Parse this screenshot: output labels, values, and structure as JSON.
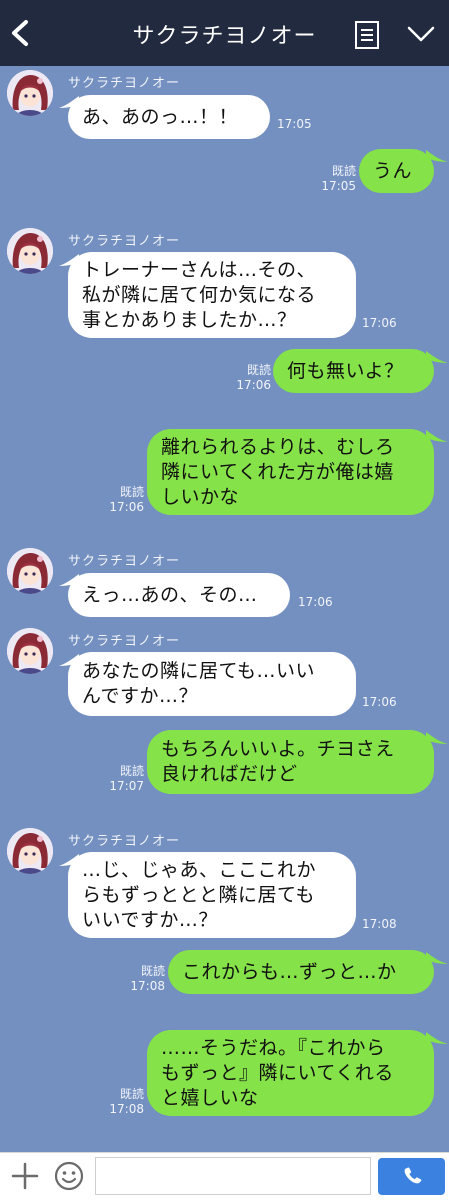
{
  "header": {
    "title": "サクラチヨノオー"
  },
  "messages": [
    {
      "sender": "サクラチヨノオー",
      "lines": [
        "あ、あのっ…！！"
      ],
      "time": "17:05"
    },
    {
      "read": "既読",
      "time": "17:05",
      "lines": [
        "うん"
      ]
    },
    {
      "sender": "サクラチヨノオー",
      "lines": [
        "トレーナーさんは…その、",
        "私が隣に居て何か気になる",
        "事とかありましたか…？"
      ],
      "time": "17:06"
    },
    {
      "read": "既読",
      "time": "17:06",
      "lines": [
        "何も無いよ？"
      ]
    },
    {
      "read": "既読",
      "time": "17:06",
      "lines": [
        "離れられるよりは、むしろ",
        "隣にいてくれた方が俺は嬉",
        "しいかな"
      ]
    },
    {
      "sender": "サクラチヨノオー",
      "lines": [
        "えっ…あの、その…"
      ],
      "time": "17:06"
    },
    {
      "sender": "サクラチヨノオー",
      "lines": [
        "あなたの隣に居ても…いい",
        "んですか…？"
      ],
      "time": "17:06"
    },
    {
      "read": "既読",
      "time": "17:07",
      "lines": [
        "もちろんいいよ。チヨさえ",
        "良ければだけど"
      ]
    },
    {
      "sender": "サクラチヨノオー",
      "lines": [
        "…じ、じゃあ、こここれか",
        "らもずっととと隣に居ても",
        "いいですか…？"
      ],
      "time": "17:08"
    },
    {
      "read": "既読",
      "time": "17:08",
      "lines": [
        "これからも…ずっと…か"
      ]
    },
    {
      "read": "既読",
      "time": "17:08",
      "lines": [
        "……そうだね。『これから",
        "もずっと』隣にいてくれる",
        "と嬉しいな"
      ]
    }
  ],
  "footer": {
    "input_value": "",
    "input_placeholder": ""
  },
  "colors": {
    "background": "#7390c0",
    "header": "#222a3f",
    "incoming_bubble": "#ffffff",
    "outgoing_bubble": "#85e249",
    "send_button": "#3b82e0"
  }
}
